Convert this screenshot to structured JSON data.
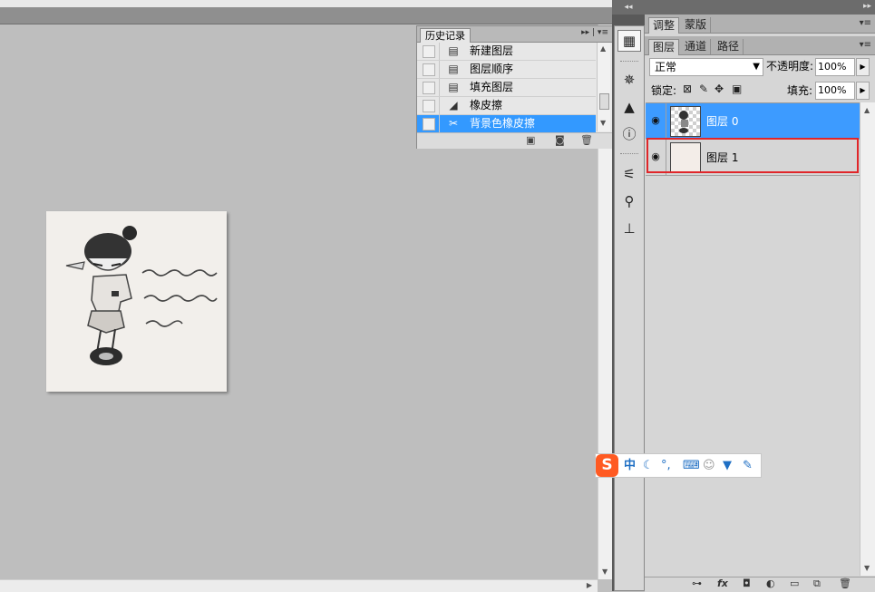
{
  "history": {
    "tab": "历史记录",
    "items": [
      {
        "label": "新建图层",
        "icon": "document-icon",
        "selected": false
      },
      {
        "label": "图层顺序",
        "icon": "document-icon",
        "selected": false
      },
      {
        "label": "填充图层",
        "icon": "document-icon",
        "selected": false
      },
      {
        "label": "橡皮擦",
        "icon": "eraser-icon",
        "selected": false
      },
      {
        "label": "背景色橡皮擦",
        "icon": "background-eraser-icon",
        "selected": true
      }
    ]
  },
  "right_panel": {
    "tabs_top": [
      "调整",
      "蒙版"
    ],
    "tabs_layers": [
      "图层",
      "通道",
      "路径"
    ],
    "blend_mode": "正常",
    "opacity_label": "不透明度:",
    "opacity_value": "100%",
    "lock_label": "锁定:",
    "fill_label": "填充:",
    "fill_value": "100%",
    "layers": [
      {
        "name": "图层 0",
        "selected": true
      },
      {
        "name": "图层 1",
        "selected": false
      }
    ]
  },
  "ime": {
    "logo": "S",
    "mode": "中"
  },
  "colors": {
    "selection_blue": "#3d9bff",
    "highlight_red": "#e0262a",
    "ime_orange": "#ff5a22"
  }
}
